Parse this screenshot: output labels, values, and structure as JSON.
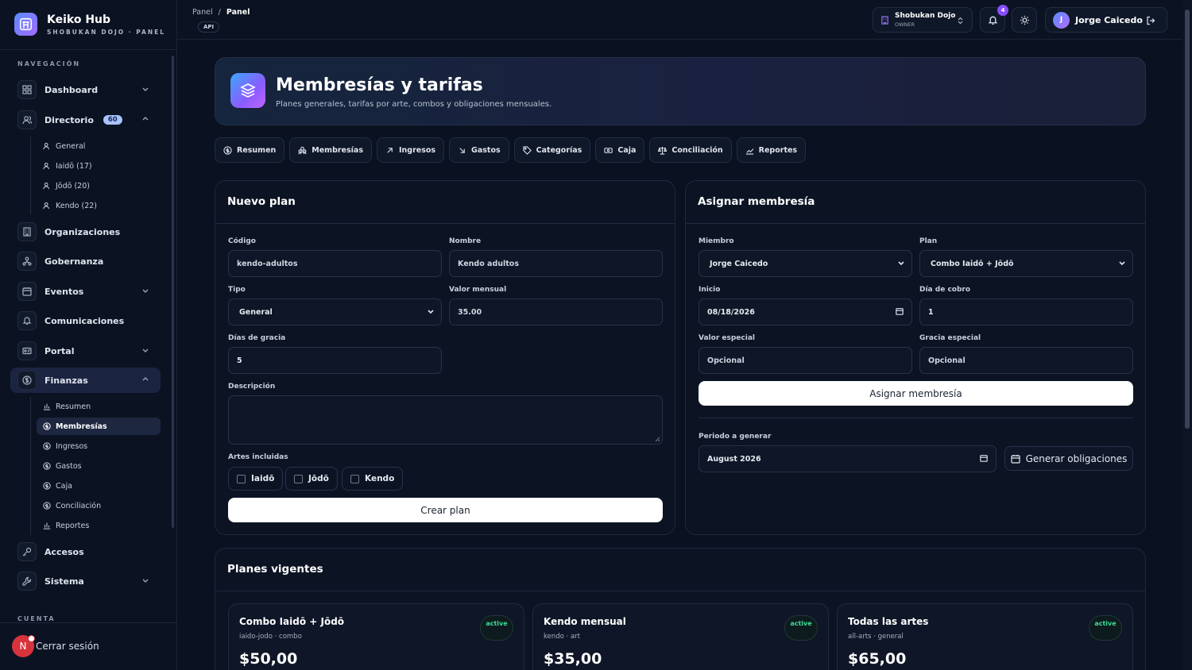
{
  "brand": {
    "title": "Keiko Hub",
    "subtitle": "SHOBUKAN DOJO · PANEL"
  },
  "sidebar": {
    "nav_label": "NAVEGACIÓN",
    "account_label": "CUENTA",
    "items": [
      {
        "label": "Dashboard"
      },
      {
        "label": "Directorio",
        "badge": "60"
      },
      {
        "label": "Organizaciones"
      },
      {
        "label": "Gobernanza"
      },
      {
        "label": "Eventos"
      },
      {
        "label": "Comunicaciones"
      },
      {
        "label": "Portal"
      },
      {
        "label": "Finanzas"
      },
      {
        "label": "Accesos"
      },
      {
        "label": "Sistema"
      }
    ],
    "directorio_sub": [
      "General",
      "Iaidō (17)",
      "Jōdō (20)",
      "Kendo (22)"
    ],
    "finanzas_sub": [
      "Resumen",
      "Membresías",
      "Ingresos",
      "Gastos",
      "Caja",
      "Conciliación",
      "Reportes"
    ],
    "logout": {
      "avatar": "N",
      "label": "Cerrar sesión"
    }
  },
  "topbar": {
    "crumb_root": "Panel",
    "crumb_sep": "/",
    "crumb_current": "Panel",
    "api_badge": "API",
    "org_name": "Shobukan Dojo",
    "org_role": "OWNER",
    "notif_count": "4",
    "user_initial": "J",
    "user_name": "Jorge Caicedo"
  },
  "hero": {
    "title": "Membresías y tarifas",
    "subtitle": "Planes generales, tarifas por arte, combos y obligaciones mensuales."
  },
  "tabs": [
    "Resumen",
    "Membresías",
    "Ingresos",
    "Gastos",
    "Categorías",
    "Caja",
    "Conciliación",
    "Reportes"
  ],
  "new_plan": {
    "title": "Nuevo plan",
    "code_label": "Código",
    "code_placeholder": "kendo-adultos",
    "name_label": "Nombre",
    "name_placeholder": "Kendo adultos",
    "type_label": "Tipo",
    "type_value": "General",
    "monthly_label": "Valor mensual",
    "monthly_placeholder": "35.00",
    "grace_label": "Días de gracia",
    "grace_value": "5",
    "desc_label": "Descripción",
    "arts_label": "Artes incluidas",
    "arts": [
      "Iaidō",
      "Jōdō",
      "Kendo"
    ],
    "submit": "Crear plan"
  },
  "assign": {
    "title": "Asignar membresía",
    "member_label": "Miembro",
    "member_value": "Jorge Caicedo",
    "plan_label": "Plan",
    "plan_value": "Combo Iaidō + Jōdō",
    "start_label": "Inicio",
    "start_value": "08/18/2026",
    "day_label": "Día de cobro",
    "day_value": "1",
    "special_value_label": "Valor especial",
    "special_value_placeholder": "Opcional",
    "special_grace_label": "Gracia especial",
    "special_grace_placeholder": "Opcional",
    "submit": "Asignar membresía",
    "period_label": "Periodo a generar",
    "period_value": "August 2026",
    "generate": "Generar obligaciones"
  },
  "plans": {
    "title": "Planes vigentes",
    "items": [
      {
        "name": "Combo Iaidō + Jōdō",
        "meta": "iaido-jodo · combo",
        "price": "$50,00",
        "status": "active"
      },
      {
        "name": "Kendo mensual",
        "meta": "kendo · art",
        "price": "$35,00",
        "status": "active"
      },
      {
        "name": "Todas las artes",
        "meta": "all-arts · general",
        "price": "$65,00",
        "status": "active"
      }
    ]
  }
}
